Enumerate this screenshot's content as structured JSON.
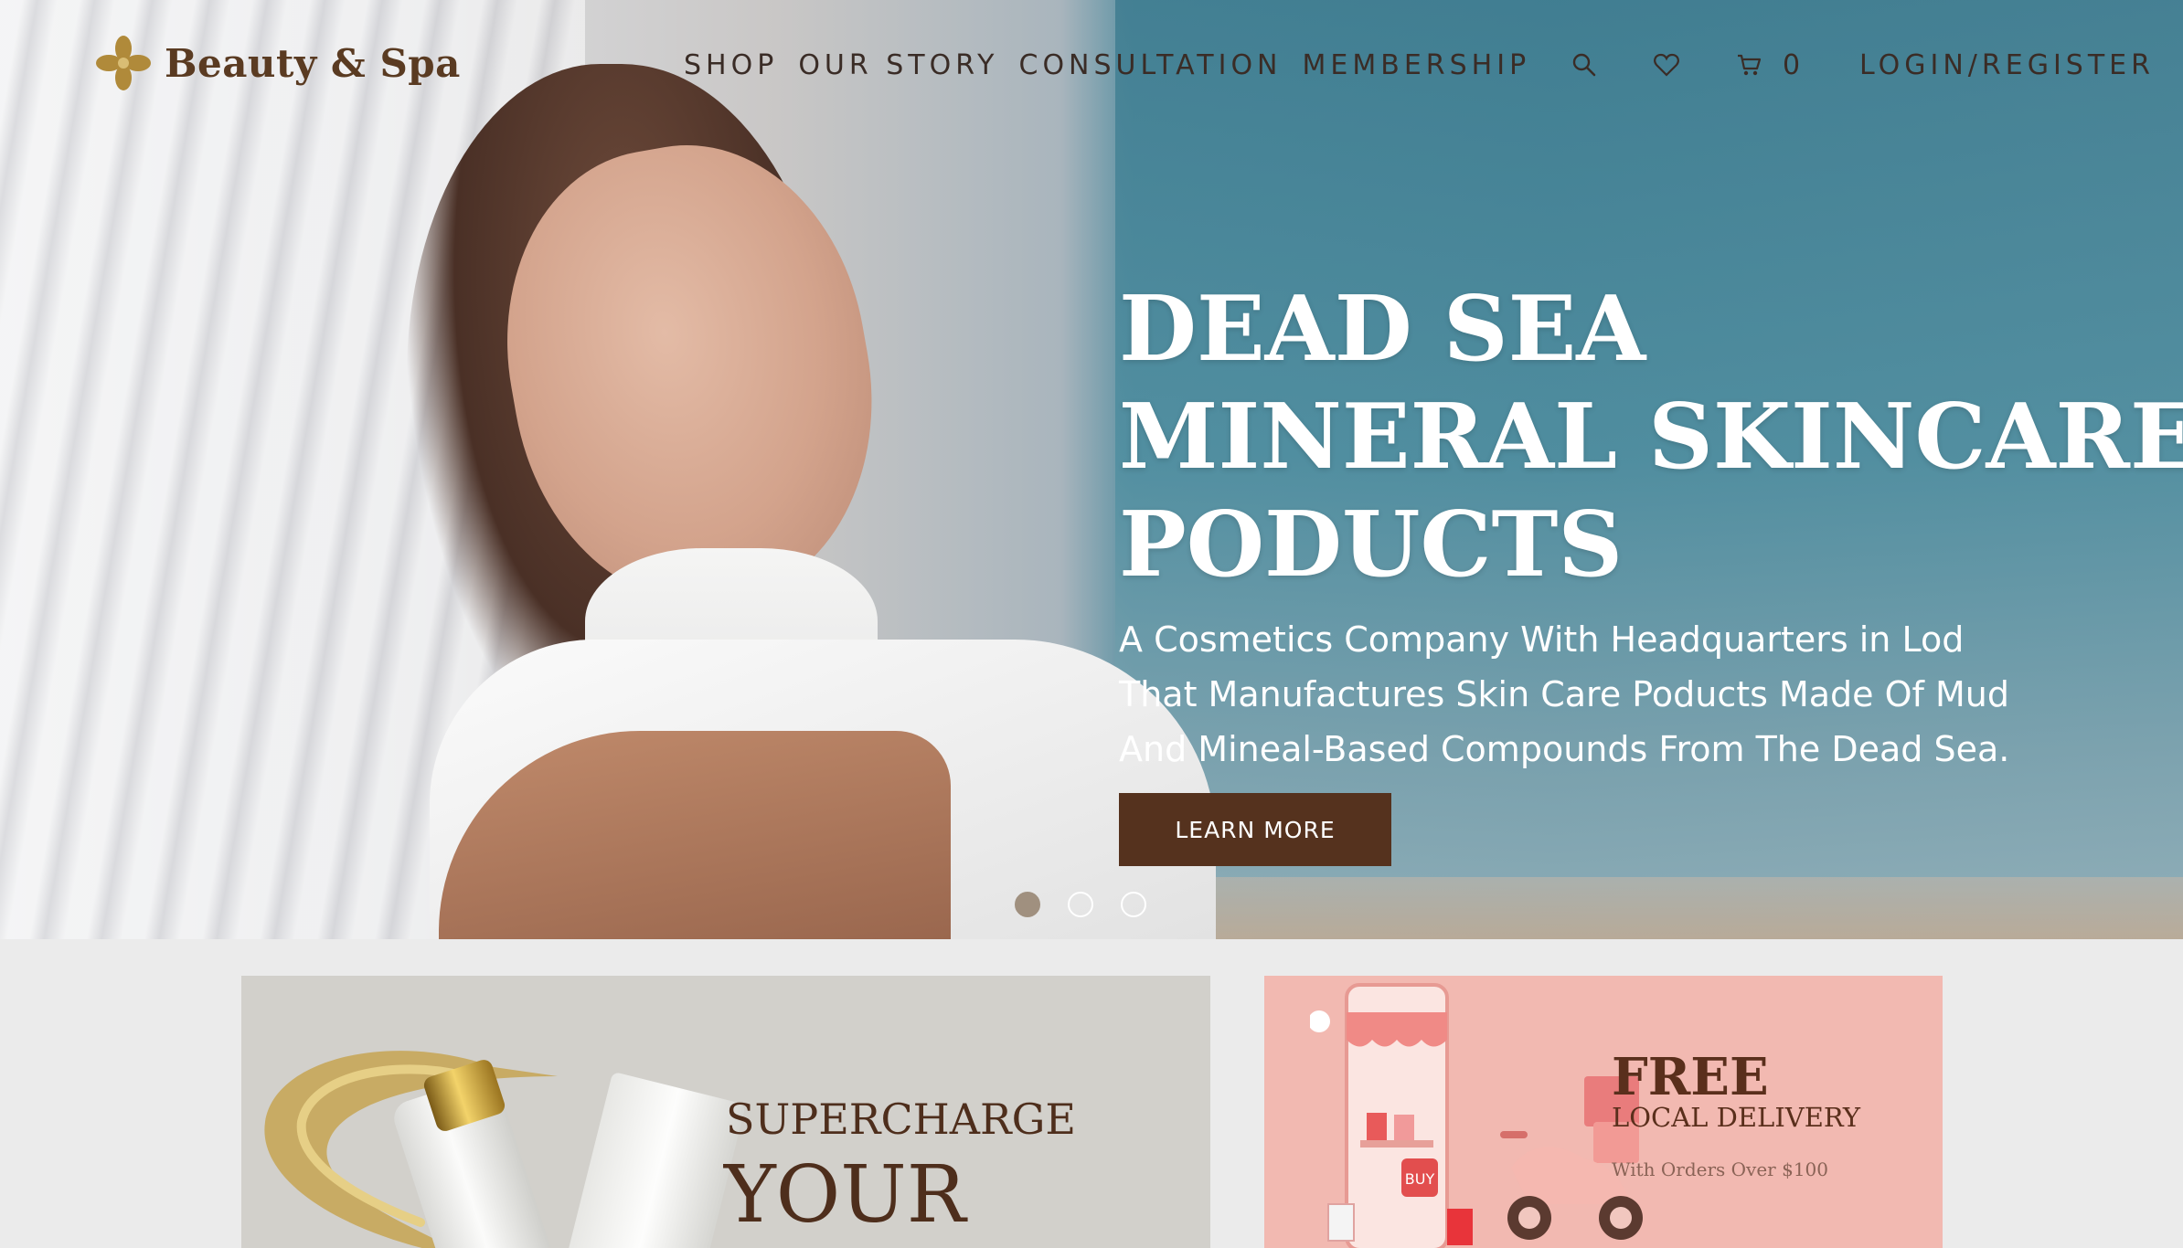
{
  "brand": {
    "name": "Beauty & Spa",
    "logo_icon": "flower-logo-icon",
    "color": "#b08a3a"
  },
  "nav": {
    "items": [
      "SHOP",
      "OUR STORY",
      "CONSULTATION",
      "MEMBERSHIP"
    ]
  },
  "header": {
    "search_icon": "search-icon",
    "wishlist_icon": "heart-icon",
    "cart_icon": "cart-icon",
    "cart_count": "0",
    "login_label": "LOGIN/REGISTER"
  },
  "hero": {
    "title_lines": [
      "DEAD SEA",
      "MINERAL SKINCARE",
      "PODUCTS"
    ],
    "subtitle_lines": [
      "A Cosmetics Company With Headquarters in Lod",
      "That Manufactures Skin Care Poducts Made Of Mud",
      "And Mineal-Based Compounds From The Dead Sea."
    ],
    "cta_label": "LEARN MORE",
    "cta_color": "#55321e",
    "slides_total": 3,
    "active_slide": 1
  },
  "promo_left": {
    "line1": "SUPERCHARGE",
    "line2": "YOUR"
  },
  "promo_right": {
    "title": "FREE",
    "subtitle": "LOCAL DELIVERY",
    "note": "With Orders Over $100",
    "badge_text": "BUY"
  }
}
